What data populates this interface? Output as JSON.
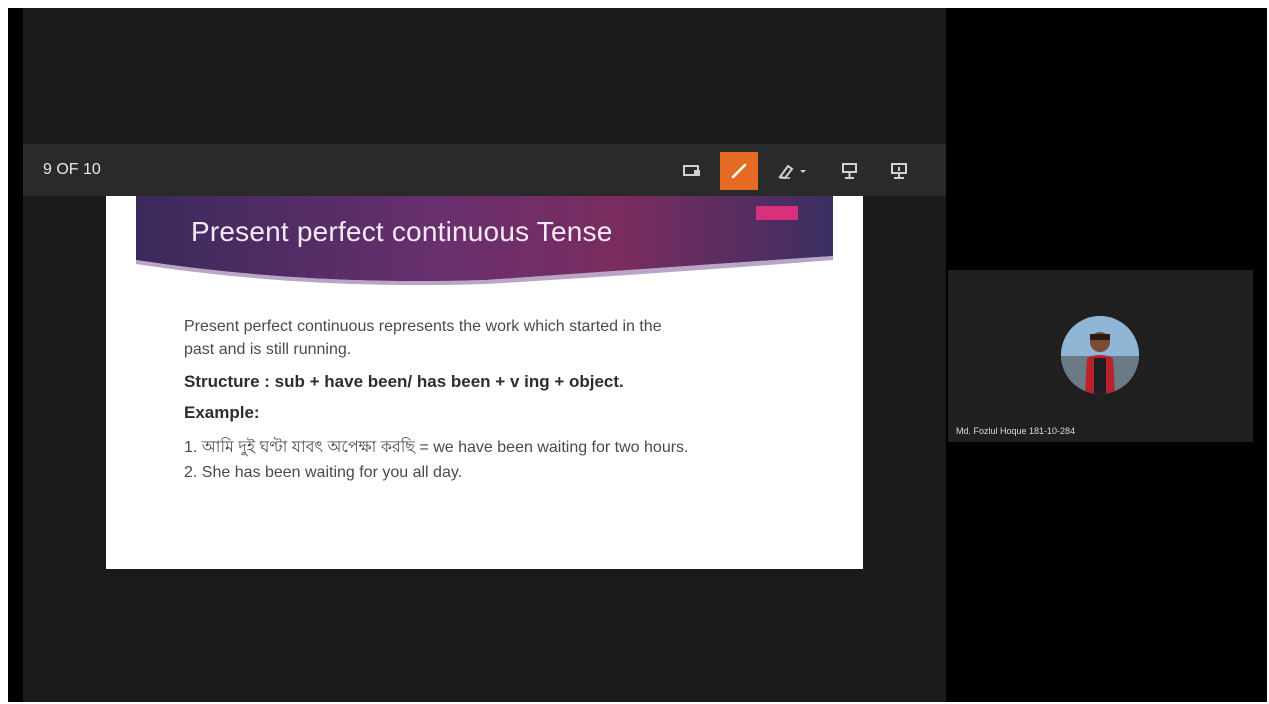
{
  "presentation": {
    "slide_counter": "9 OF 10"
  },
  "toolbar": {
    "buttons": [
      {
        "name": "screen-icon"
      },
      {
        "name": "pen-icon",
        "active": true
      },
      {
        "name": "highlighter-icon"
      },
      {
        "name": "pointer-icon"
      },
      {
        "name": "presenter-icon"
      }
    ],
    "accent_color": "#e56a24"
  },
  "slide": {
    "title": "Present perfect  continuous Tense",
    "definition_line1": " Present  perfect  continuous  represents the work which started in the",
    "definition_line2": "past  and is still running.",
    "structure": "Structure : sub + have been/ has been + v ing + object.",
    "example_heading": "Example:",
    "example_1": "1. আমি দুই ঘণ্টা  যাবৎ অপেক্ষা করছি = we have been waiting for two hours.",
    "example_2": " 2. She has been waiting for you all day."
  },
  "participant": {
    "name": "Md. Fozlul Hoque 181-10-284"
  }
}
